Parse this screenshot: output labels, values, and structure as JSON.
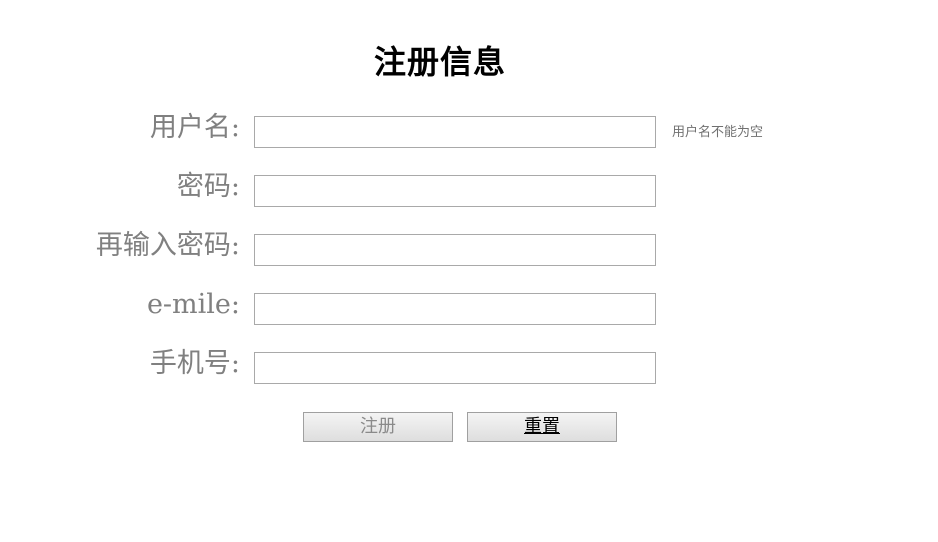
{
  "form": {
    "title": "注册信息",
    "fields": [
      {
        "label": "用户名:",
        "value": "",
        "hint": "用户名不能为空"
      },
      {
        "label": "密码:",
        "value": ""
      },
      {
        "label": "再输入密码:",
        "value": ""
      },
      {
        "label": "e-mile:",
        "value": ""
      },
      {
        "label": "手机号:",
        "value": ""
      }
    ],
    "buttons": {
      "register_label": "注册",
      "reset_label": "重置"
    }
  }
}
